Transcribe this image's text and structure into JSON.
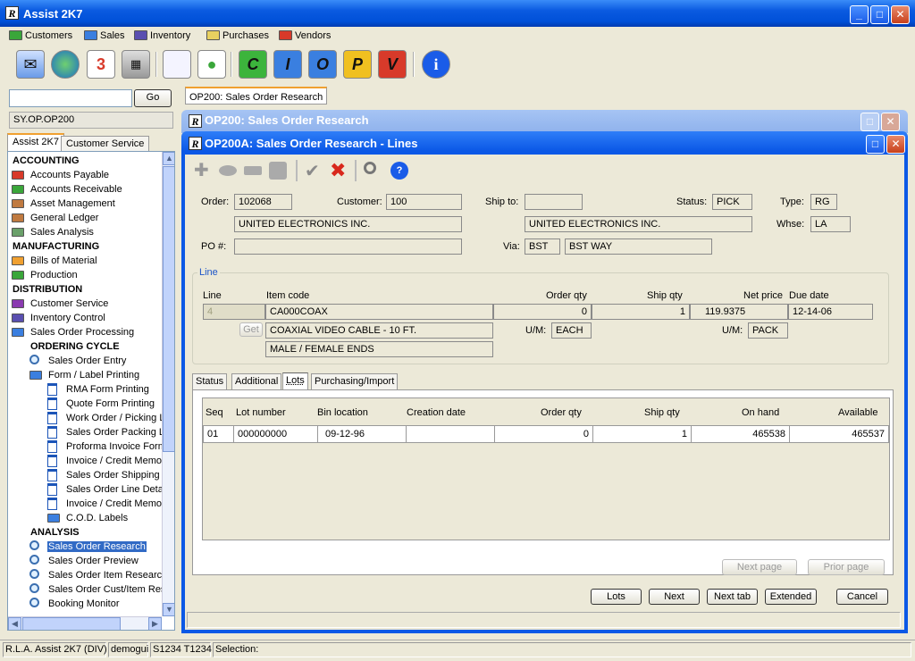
{
  "app": {
    "title": "Assist 2K7"
  },
  "menu": [
    "Customers",
    "Sales",
    "Inventory",
    "Purchases",
    "Vendors"
  ],
  "menu_colors": [
    "#3aa63a",
    "#3b7fe0",
    "#5a4fb0",
    "#e8d060",
    "#d83a2a"
  ],
  "toolbar": {
    "letters": [
      "C",
      "I",
      "O",
      "P",
      "V"
    ],
    "colors": [
      "#3cb43c",
      "#3a7fe0",
      "#3a7fe0",
      "#f0c020",
      "#d83a2a"
    ]
  },
  "left": {
    "go_label": "Go",
    "path": "SY.OP.OP200",
    "tabs": [
      "Assist 2K7",
      "Customer Service"
    ],
    "tree": [
      {
        "t": "ACCOUNTING",
        "k": "hdr",
        "x": 4
      },
      {
        "t": "Accounts Payable",
        "k": "f",
        "c": "#d83a2a",
        "x": 4
      },
      {
        "t": "Accounts Receivable",
        "k": "f",
        "c": "#3aa63a",
        "x": 4
      },
      {
        "t": "Asset Management",
        "k": "f",
        "c": "#c07a40",
        "x": 4
      },
      {
        "t": "General Ledger",
        "k": "f",
        "c": "#c07a40",
        "x": 4
      },
      {
        "t": "Sales Analysis",
        "k": "f",
        "c": "#6aa06a",
        "x": 4
      },
      {
        "t": "MANUFACTURING",
        "k": "hdr",
        "x": 4
      },
      {
        "t": "Bills of Material",
        "k": "f",
        "c": "#f0a030",
        "x": 4
      },
      {
        "t": "Production",
        "k": "f",
        "c": "#3aa63a",
        "x": 4
      },
      {
        "t": "DISTRIBUTION",
        "k": "hdr",
        "x": 4
      },
      {
        "t": "Customer Service",
        "k": "f",
        "c": "#8a3ab0",
        "x": 4
      },
      {
        "t": "Inventory Control",
        "k": "f",
        "c": "#5a4fb0",
        "x": 4
      },
      {
        "t": "Sales Order Processing",
        "k": "f",
        "c": "#3b7fe0",
        "x": 4
      },
      {
        "t": "ORDERING CYCLE",
        "k": "hdr",
        "x": 24
      },
      {
        "t": "Sales Order Entry",
        "k": "m",
        "x": 24
      },
      {
        "t": "Form / Label Printing",
        "k": "f",
        "c": "#3b7fe0",
        "x": 24
      },
      {
        "t": "RMA Form Printing",
        "k": "d",
        "x": 44
      },
      {
        "t": "Quote Form Printing",
        "k": "d",
        "x": 44
      },
      {
        "t": "Work Order / Picking Li",
        "k": "d",
        "x": 44
      },
      {
        "t": "Sales Order Packing Lis",
        "k": "d",
        "x": 44
      },
      {
        "t": "Proforma Invoice Form",
        "k": "d",
        "x": 44
      },
      {
        "t": "Invoice / Credit Memo",
        "k": "d",
        "x": 44
      },
      {
        "t": "Sales Order Shipping L",
        "k": "d",
        "x": 44
      },
      {
        "t": "Sales Order Line Detail",
        "k": "d",
        "x": 44
      },
      {
        "t": "Invoice / Credit Memo",
        "k": "d",
        "x": 44
      },
      {
        "t": "C.O.D. Labels",
        "k": "f",
        "c": "#3b7fe0",
        "x": 44
      },
      {
        "t": "ANALYSIS",
        "k": "hdr",
        "x": 24
      },
      {
        "t": "Sales Order Research",
        "k": "m",
        "x": 24,
        "sel": true
      },
      {
        "t": "Sales Order Preview",
        "k": "m",
        "x": 24
      },
      {
        "t": "Sales Order Item Research",
        "k": "m",
        "x": 24
      },
      {
        "t": "Sales Order Cust/Item Res",
        "k": "m",
        "x": 24
      },
      {
        "t": "Booking Monitor",
        "k": "m",
        "x": 24
      }
    ]
  },
  "doc_tab": "OP200: Sales Order Research",
  "bg_window_title": "OP200: Sales Order Research",
  "window_title": "OP200A: Sales Order Research - Lines",
  "header": {
    "order_label": "Order:",
    "order": "102068",
    "customer_label": "Customer:",
    "customer": "100",
    "shipto_label": "Ship to:",
    "shipto": "",
    "status_label": "Status:",
    "status": "PICK",
    "type_label": "Type:",
    "type": "RG",
    "customer_name": "UNITED ELECTRONICS INC.",
    "shipto_name": "UNITED ELECTRONICS INC.",
    "whse_label": "Whse:",
    "whse": "LA",
    "po_label": "PO #:",
    "po": "",
    "via_label": "Via:",
    "via_code": "BST",
    "via_name": "BST WAY"
  },
  "line": {
    "group_label": "Line",
    "h_line": "Line",
    "h_item": "Item code",
    "h_order": "Order qty",
    "h_ship": "Ship qty",
    "h_net": "Net price",
    "h_due": "Due date",
    "line": "4",
    "item": "CA000COAX",
    "order_qty": "0",
    "ship_qty": "1",
    "net_price": "119.9375",
    "due_date": "12-14-06",
    "get_label": "Get",
    "desc1": "COAXIAL VIDEO CABLE - 10 FT.",
    "desc2": "MALE / FEMALE ENDS",
    "um_label": "U/M:",
    "um1": "EACH",
    "um2": "PACK"
  },
  "tabs": [
    "Status",
    "Additional",
    "Lots",
    "Purchasing/Import"
  ],
  "lots": {
    "headers": [
      "Seq",
      "Lot number",
      "Bin location",
      "Creation date",
      "Order qty",
      "Ship qty",
      "On hand",
      "Available"
    ],
    "rows": [
      [
        "01",
        "000000000",
        "09-12-96",
        "",
        "0",
        "1",
        "465538",
        "465537"
      ]
    ],
    "next_page": "Next page",
    "prior_page": "Prior page"
  },
  "buttons": {
    "lots": "Lots",
    "next": "Next",
    "next_tab": "Next tab",
    "extended": "Extended",
    "cancel": "Cancel"
  },
  "status": {
    "app": "R.L.A. Assist 2K7 (DIV)",
    "user": "demogui",
    "ids": "S1234 T1234",
    "selection": "Selection:"
  }
}
